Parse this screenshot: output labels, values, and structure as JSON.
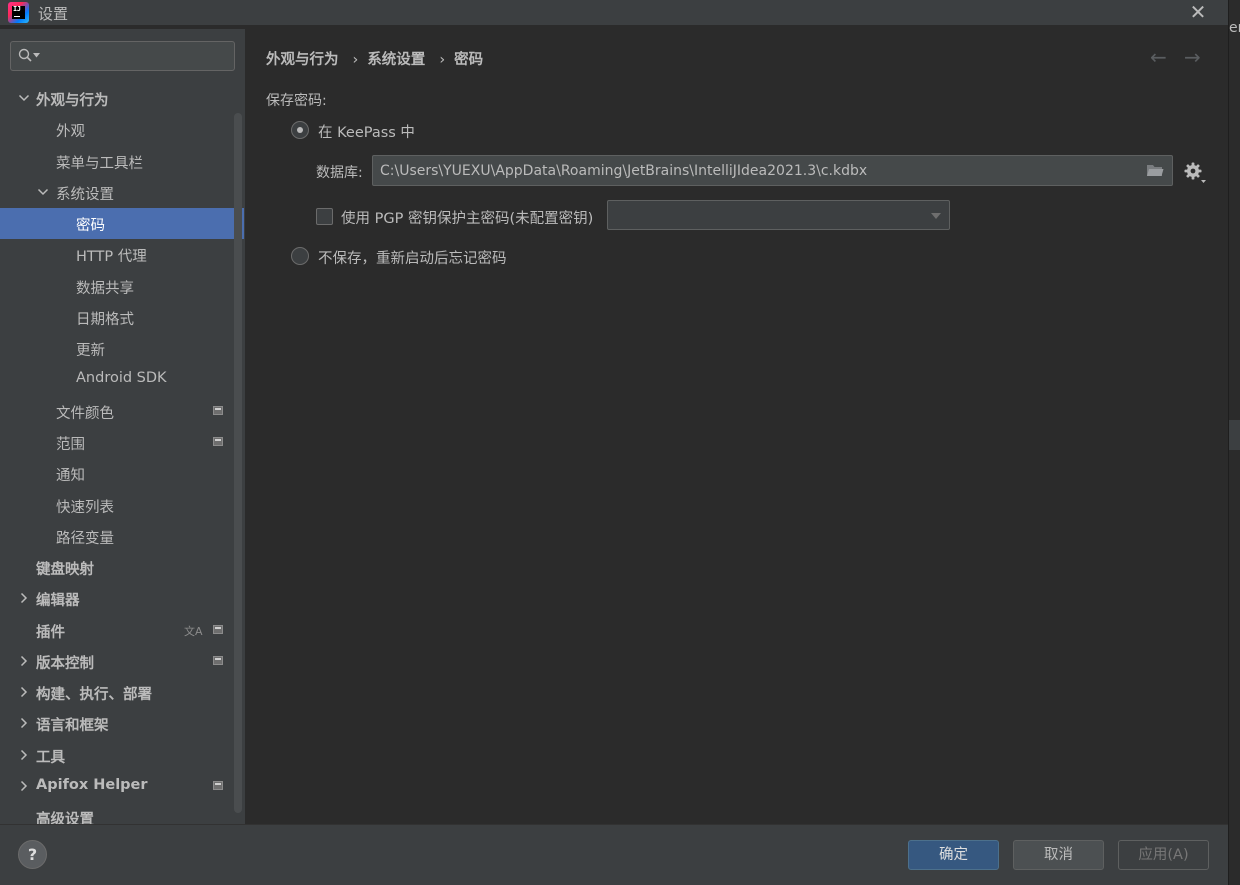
{
  "window": {
    "title": "设置",
    "close_glyph": "✕"
  },
  "background_ide": {
    "edge_text": "er"
  },
  "sidebar": {
    "search": {
      "value": "",
      "placeholder": ""
    },
    "tree": [
      {
        "label": "外观与行为",
        "level": 0,
        "bold": true,
        "expanded": true
      },
      {
        "label": "外观",
        "level": 1
      },
      {
        "label": "菜单与工具栏",
        "level": 1
      },
      {
        "label": "系统设置",
        "level": 1,
        "expanded": true
      },
      {
        "label": "密码",
        "level": 2,
        "selected": true
      },
      {
        "label": "HTTP 代理",
        "level": 2
      },
      {
        "label": "数据共享",
        "level": 2
      },
      {
        "label": "日期格式",
        "level": 2
      },
      {
        "label": "更新",
        "level": 2
      },
      {
        "label": "Android SDK",
        "level": 2
      },
      {
        "label": "文件颜色",
        "level": 1,
        "badge": true
      },
      {
        "label": "范围",
        "level": 1,
        "badge": true
      },
      {
        "label": "通知",
        "level": 1
      },
      {
        "label": "快速列表",
        "level": 1
      },
      {
        "label": "路径变量",
        "level": 1
      },
      {
        "label": "键盘映射",
        "level": 0,
        "bold": true
      },
      {
        "label": "编辑器",
        "level": 0,
        "bold": true,
        "collapsed": true
      },
      {
        "label": "插件",
        "level": 0,
        "bold": true,
        "badge": true,
        "lang_icon": true
      },
      {
        "label": "版本控制",
        "level": 0,
        "bold": true,
        "collapsed": true,
        "badge": true
      },
      {
        "label": "构建、执行、部署",
        "level": 0,
        "bold": true,
        "collapsed": true
      },
      {
        "label": "语言和框架",
        "level": 0,
        "bold": true,
        "collapsed": true
      },
      {
        "label": "工具",
        "level": 0,
        "bold": true,
        "collapsed": true
      },
      {
        "label": "Apifox Helper",
        "level": 0,
        "bold": true,
        "collapsed": true,
        "badge": true
      },
      {
        "label": "高级设置",
        "level": 0,
        "bold": true
      }
    ]
  },
  "breadcrumb": [
    "外观与行为",
    "系统设置",
    "密码"
  ],
  "breadcrumb_separator": "›",
  "nav": {
    "back_glyph": "←",
    "forward_glyph": "→"
  },
  "password": {
    "section_label": "保存密码:",
    "keepass_option": "在 KeePass 中",
    "keepass_selected": true,
    "database_label": "数据库:",
    "database_path": "C:\\Users\\YUEXU\\AppData\\Roaming\\JetBrains\\IntelliJIdea2021.3\\c.kdbx",
    "pgp_checkbox_label": "使用 PGP 密钥保护主密码(未配置密钥)",
    "pgp_checked": false,
    "pgp_key_value": "",
    "no_save_option": "不保存，重新启动后忘记密码"
  },
  "footer": {
    "help_glyph": "?",
    "ok_label": "确定",
    "cancel_label": "取消",
    "apply_label": "应用(A)"
  },
  "colors": {
    "selection": "#4b6eaf",
    "primary_button": "#365880",
    "sidebar_bg": "#3c3f41",
    "content_bg": "#2b2b2b"
  }
}
